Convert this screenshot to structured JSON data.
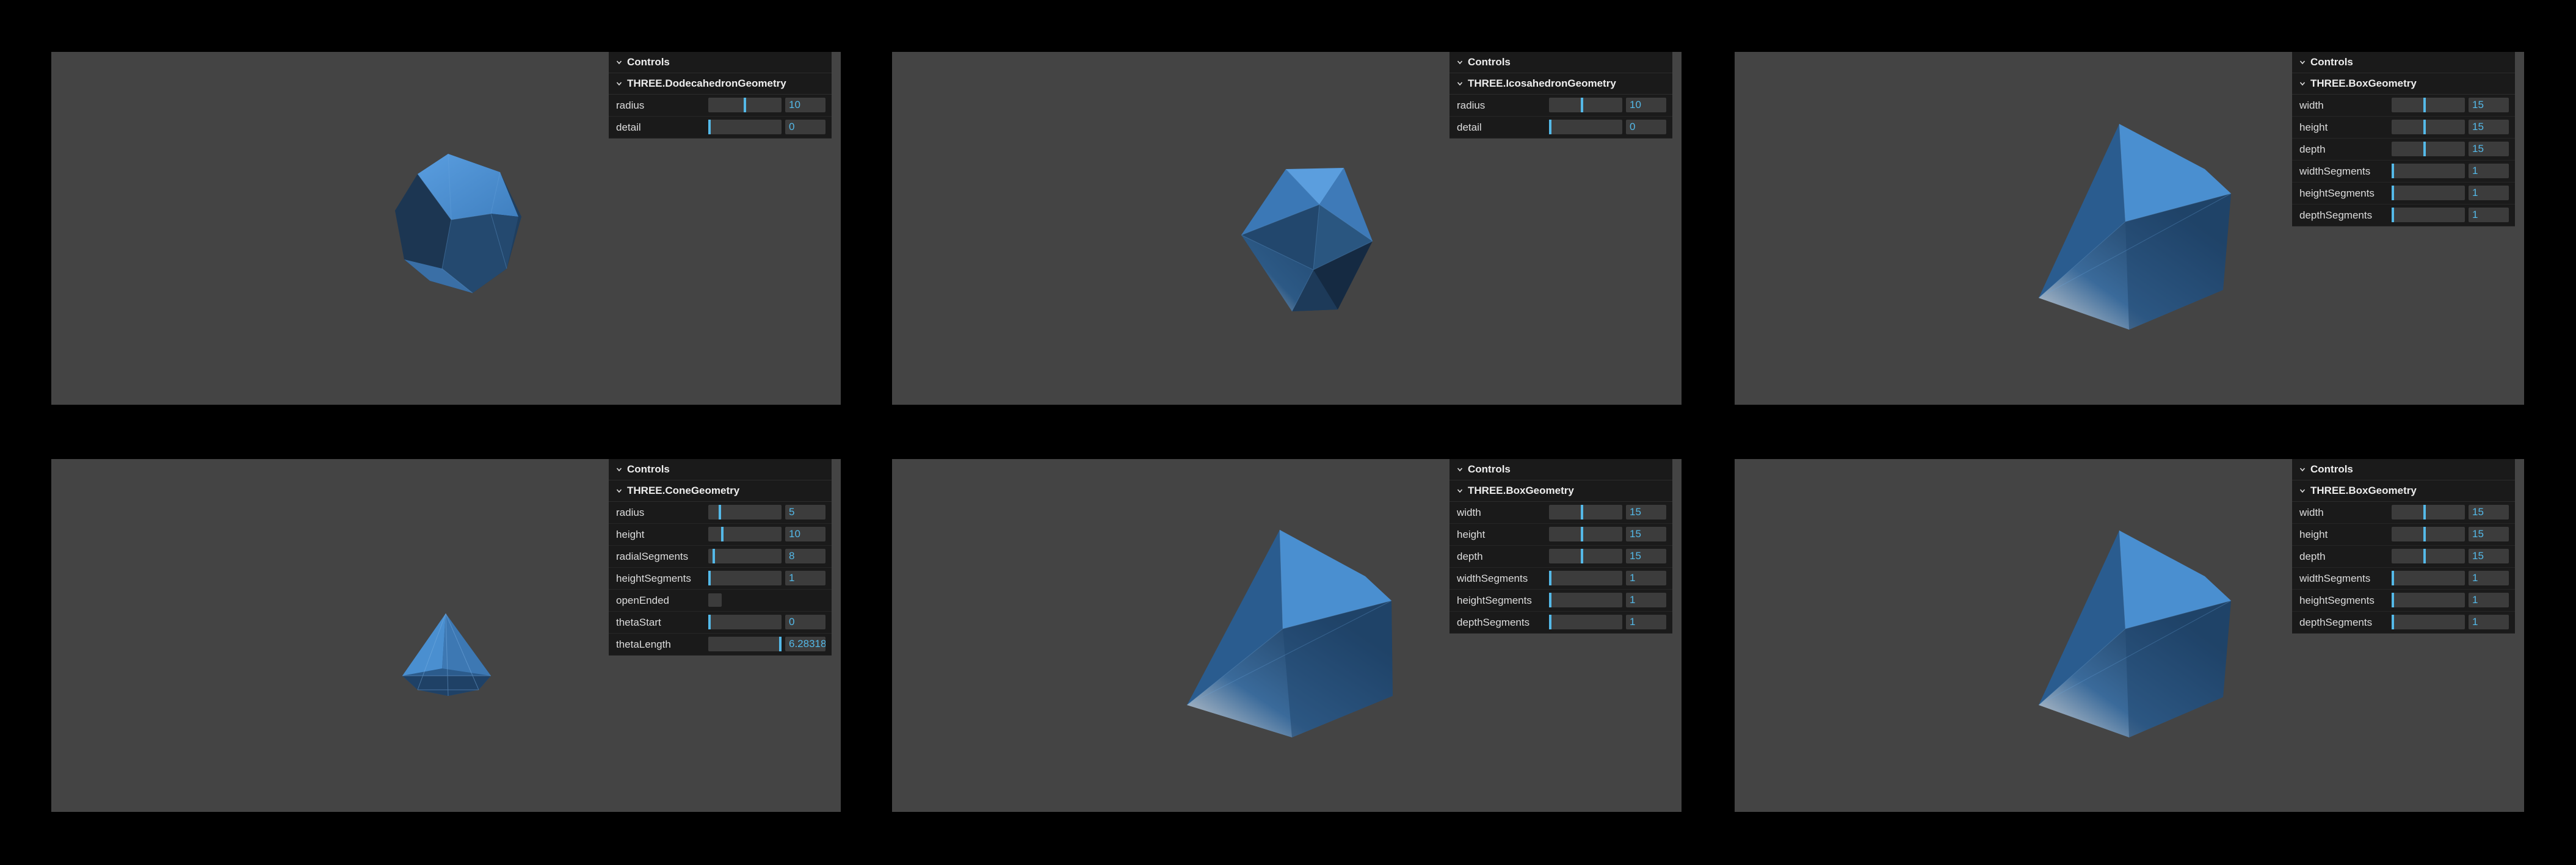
{
  "panels": [
    {
      "controls_title": "Controls",
      "folder_title": "THREE.DodecahedronGeometry",
      "rows": [
        {
          "label": "radius",
          "value": "10",
          "fill": 0.5
        },
        {
          "label": "detail",
          "value": "0",
          "fill": 0.0
        }
      ]
    },
    {
      "controls_title": "Controls",
      "folder_title": "THREE.IcosahedronGeometry",
      "rows": [
        {
          "label": "radius",
          "value": "10",
          "fill": 0.45
        },
        {
          "label": "detail",
          "value": "0",
          "fill": 0.0
        }
      ]
    },
    {
      "controls_title": "Controls",
      "folder_title": "THREE.BoxGeometry",
      "rows": [
        {
          "label": "width",
          "value": "15",
          "fill": 0.45
        },
        {
          "label": "height",
          "value": "15",
          "fill": 0.45
        },
        {
          "label": "depth",
          "value": "15",
          "fill": 0.45
        },
        {
          "label": "widthSegments",
          "value": "1",
          "fill": 0.0
        },
        {
          "label": "heightSegments",
          "value": "1",
          "fill": 0.0
        },
        {
          "label": "depthSegments",
          "value": "1",
          "fill": 0.0
        }
      ]
    },
    {
      "controls_title": "Controls",
      "folder_title": "THREE.ConeGeometry",
      "rows": [
        {
          "label": "radius",
          "value": "5",
          "fill": 0.15
        },
        {
          "label": "height",
          "value": "10",
          "fill": 0.18
        },
        {
          "label": "radialSegments",
          "value": "8",
          "fill": 0.06
        },
        {
          "label": "heightSegments",
          "value": "1",
          "fill": 0.0
        },
        {
          "label": "openEnded",
          "checkbox": true
        },
        {
          "label": "thetaStart",
          "value": "0",
          "fill": 0.0
        },
        {
          "label": "thetaLength",
          "value": "6.28318",
          "fill": 1.0
        }
      ]
    },
    {
      "controls_title": "Controls",
      "folder_title": "THREE.BoxGeometry",
      "rows": [
        {
          "label": "width",
          "value": "15",
          "fill": 0.45
        },
        {
          "label": "height",
          "value": "15",
          "fill": 0.45
        },
        {
          "label": "depth",
          "value": "15",
          "fill": 0.45
        },
        {
          "label": "widthSegments",
          "value": "1",
          "fill": 0.0
        },
        {
          "label": "heightSegments",
          "value": "1",
          "fill": 0.0
        },
        {
          "label": "depthSegments",
          "value": "1",
          "fill": 0.0
        }
      ]
    },
    {
      "controls_title": "Controls",
      "folder_title": "THREE.BoxGeometry",
      "rows": [
        {
          "label": "width",
          "value": "15",
          "fill": 0.45
        },
        {
          "label": "height",
          "value": "15",
          "fill": 0.45
        },
        {
          "label": "depth",
          "value": "15",
          "fill": 0.45
        },
        {
          "label": "widthSegments",
          "value": "1",
          "fill": 0.0
        },
        {
          "label": "heightSegments",
          "value": "1",
          "fill": 0.0
        },
        {
          "label": "depthSegments",
          "value": "1",
          "fill": 0.0
        }
      ]
    }
  ],
  "colors": {
    "background": "#000000",
    "viewport": "#444444",
    "accent": "#54b9e8",
    "mesh_light": "#4a8fd0",
    "mesh_mid": "#2e5f8f",
    "mesh_dark": "#1d3b5c"
  },
  "icons": {
    "chevron": "chevron-down-icon"
  }
}
